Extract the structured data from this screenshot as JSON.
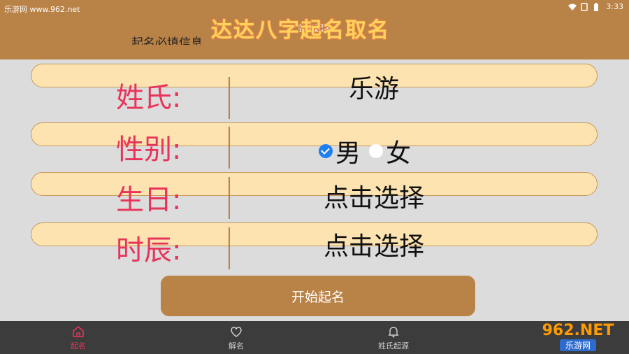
{
  "status_bar": {
    "site": "乐游网 www.962.net",
    "time": "3:33"
  },
  "header": {
    "title": "达达八字起名取名",
    "subtitle": "宝宝起名",
    "section_heading": "起名必填信息"
  },
  "form": {
    "surname": {
      "label": "姓氏:",
      "value": "乐游"
    },
    "gender": {
      "label": "性别:",
      "options": [
        {
          "label": "男",
          "selected": true
        },
        {
          "label": "女",
          "selected": false
        }
      ]
    },
    "birthday": {
      "label": "生日:",
      "value": "点击选择"
    },
    "hour": {
      "label": "时辰:",
      "value": "点击选择"
    }
  },
  "start_button": {
    "label": "开始起名"
  },
  "bottom_nav": [
    {
      "label": "起名",
      "icon": "home-icon",
      "active": true
    },
    {
      "label": "解名",
      "icon": "heart-icon",
      "active": false
    },
    {
      "label": "姓氏起源",
      "icon": "bell-icon",
      "active": false
    }
  ],
  "watermark": {
    "logo_text": "962.NET",
    "site_name": "乐游网"
  },
  "colors": {
    "header": "#b98246",
    "label": "#e8345a",
    "row": "#fde3b0",
    "radio_on": "#1d7ff2",
    "nav_bg": "#3c3c3c"
  }
}
